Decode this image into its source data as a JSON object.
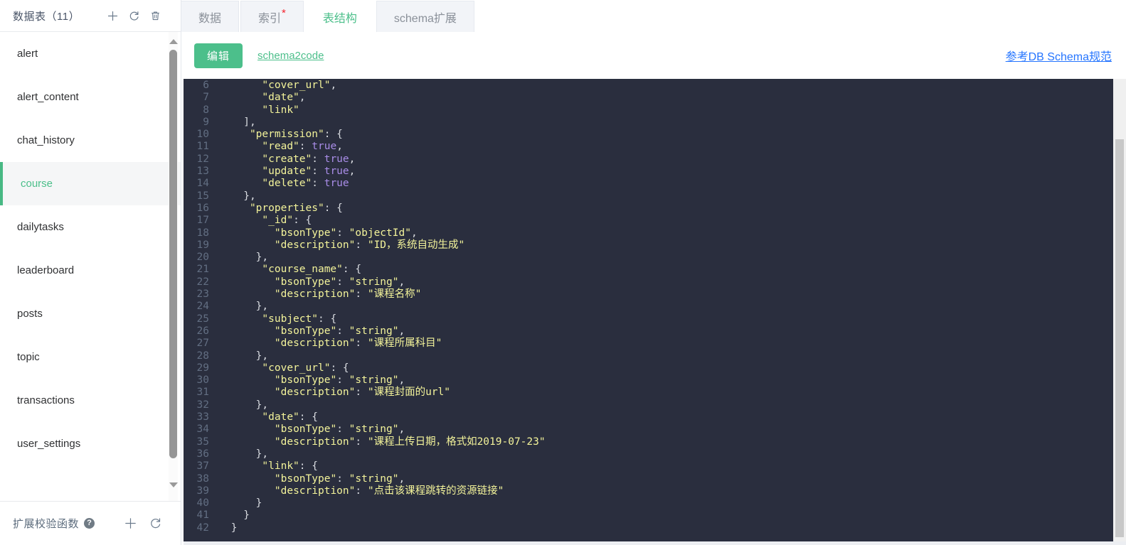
{
  "sidebar": {
    "title": "数据表（11）",
    "actions": [
      {
        "name": "add-table-button",
        "icon": "plus-icon"
      },
      {
        "name": "refresh-tables-button",
        "icon": "refresh-icon"
      },
      {
        "name": "delete-table-button",
        "icon": "trash-icon"
      }
    ],
    "items": [
      {
        "label": "alert",
        "active": false
      },
      {
        "label": "alert_content",
        "active": false
      },
      {
        "label": "chat_history",
        "active": false
      },
      {
        "label": "course",
        "active": true
      },
      {
        "label": "dailytasks",
        "active": false
      },
      {
        "label": "leaderboard",
        "active": false
      },
      {
        "label": "posts",
        "active": false
      },
      {
        "label": "topic",
        "active": false
      },
      {
        "label": "transactions",
        "active": false
      },
      {
        "label": "user_settings",
        "active": false
      }
    ],
    "footer": {
      "title": "扩展校验函数",
      "help_glyph": "?",
      "actions": [
        {
          "name": "add-validator-button",
          "icon": "plus-icon"
        },
        {
          "name": "refresh-validators-button",
          "icon": "refresh-icon"
        }
      ]
    }
  },
  "tabs": [
    {
      "label": "数据",
      "active": false,
      "badge": ""
    },
    {
      "label": "索引",
      "active": false,
      "badge": "*"
    },
    {
      "label": "表结构",
      "active": true,
      "badge": ""
    },
    {
      "label": "schema扩展",
      "active": false,
      "badge": ""
    }
  ],
  "toolbar": {
    "edit_label": "编辑",
    "schema2code_label": "schema2code",
    "spec_link_label": "参考DB Schema规范"
  },
  "colors": {
    "accent_green": "#4cbf8b",
    "link_blue": "#2575ff",
    "star_red": "#f5222d",
    "editor_bg": "#2a2e3e",
    "string_yellow": "#f3f39a",
    "boolean_purple": "#a98de8",
    "linenumber_gray": "#626e82"
  },
  "editor": {
    "first_visible_line": 6,
    "total_visible_lines": 37,
    "lines": [
      {
        "n": 6,
        "text": "      \"cover_url\","
      },
      {
        "n": 7,
        "text": "      \"date\","
      },
      {
        "n": 8,
        "text": "      \"link\""
      },
      {
        "n": 9,
        "text": "   ],"
      },
      {
        "n": 10,
        "text": "    \"permission\": {"
      },
      {
        "n": 11,
        "text": "      \"read\": true,"
      },
      {
        "n": 12,
        "text": "      \"create\": true,"
      },
      {
        "n": 13,
        "text": "      \"update\": true,"
      },
      {
        "n": 14,
        "text": "      \"delete\": true"
      },
      {
        "n": 15,
        "text": "   },"
      },
      {
        "n": 16,
        "text": "    \"properties\": {"
      },
      {
        "n": 17,
        "text": "      \"_id\": {"
      },
      {
        "n": 18,
        "text": "        \"bsonType\": \"objectId\","
      },
      {
        "n": 19,
        "text": "        \"description\": \"ID，系统自动生成\""
      },
      {
        "n": 20,
        "text": "     },"
      },
      {
        "n": 21,
        "text": "      \"course_name\": {"
      },
      {
        "n": 22,
        "text": "        \"bsonType\": \"string\","
      },
      {
        "n": 23,
        "text": "        \"description\": \"课程名称\""
      },
      {
        "n": 24,
        "text": "     },"
      },
      {
        "n": 25,
        "text": "      \"subject\": {"
      },
      {
        "n": 26,
        "text": "        \"bsonType\": \"string\","
      },
      {
        "n": 27,
        "text": "        \"description\": \"课程所属科目\""
      },
      {
        "n": 28,
        "text": "     },"
      },
      {
        "n": 29,
        "text": "      \"cover_url\": {"
      },
      {
        "n": 30,
        "text": "        \"bsonType\": \"string\","
      },
      {
        "n": 31,
        "text": "        \"description\": \"课程封面的url\""
      },
      {
        "n": 32,
        "text": "     },"
      },
      {
        "n": 33,
        "text": "      \"date\": {"
      },
      {
        "n": 34,
        "text": "        \"bsonType\": \"string\","
      },
      {
        "n": 35,
        "text": "        \"description\": \"课程上传日期，格式如2019-07-23\""
      },
      {
        "n": 36,
        "text": "     },"
      },
      {
        "n": 37,
        "text": "      \"link\": {"
      },
      {
        "n": 38,
        "text": "        \"bsonType\": \"string\","
      },
      {
        "n": 39,
        "text": "        \"description\": \"点击该课程跳转的资源链接\""
      },
      {
        "n": 40,
        "text": "     }"
      },
      {
        "n": 41,
        "text": "   }"
      },
      {
        "n": 42,
        "text": " }"
      }
    ]
  }
}
